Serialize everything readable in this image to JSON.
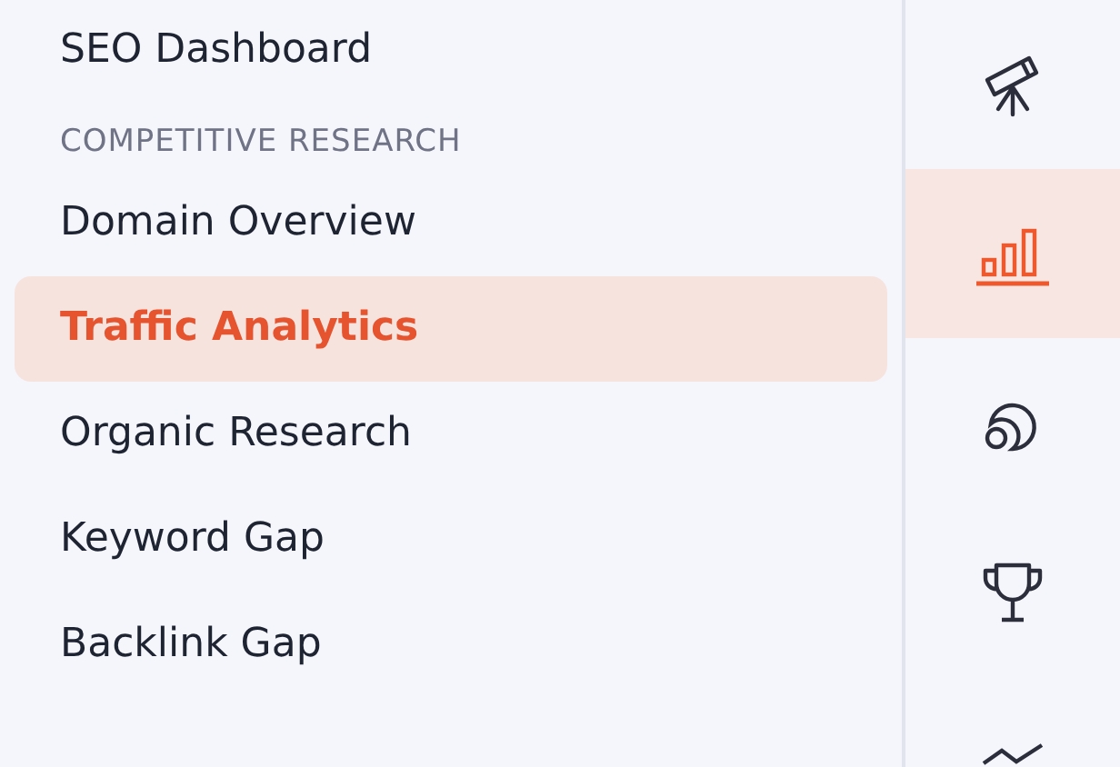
{
  "menu": [
    {
      "kind": "link",
      "label": "SEO Dashboard",
      "selected": false
    },
    {
      "kind": "header",
      "label": "COMPETITIVE RESEARCH"
    },
    {
      "kind": "link",
      "label": "Domain Overview",
      "selected": false
    },
    {
      "kind": "link",
      "label": "Traffic Analytics",
      "selected": true
    },
    {
      "kind": "link",
      "label": "Organic Research",
      "selected": false
    },
    {
      "kind": "link",
      "label": "Keyword Gap",
      "selected": false
    },
    {
      "kind": "link",
      "label": "Backlink Gap",
      "selected": false
    }
  ],
  "rail": [
    {
      "kind": "telescope",
      "selected": false
    },
    {
      "kind": "bars",
      "selected": true
    },
    {
      "kind": "rings",
      "selected": false
    },
    {
      "kind": "trophy",
      "selected": false
    },
    {
      "kind": "trend",
      "selected": false
    }
  ]
}
